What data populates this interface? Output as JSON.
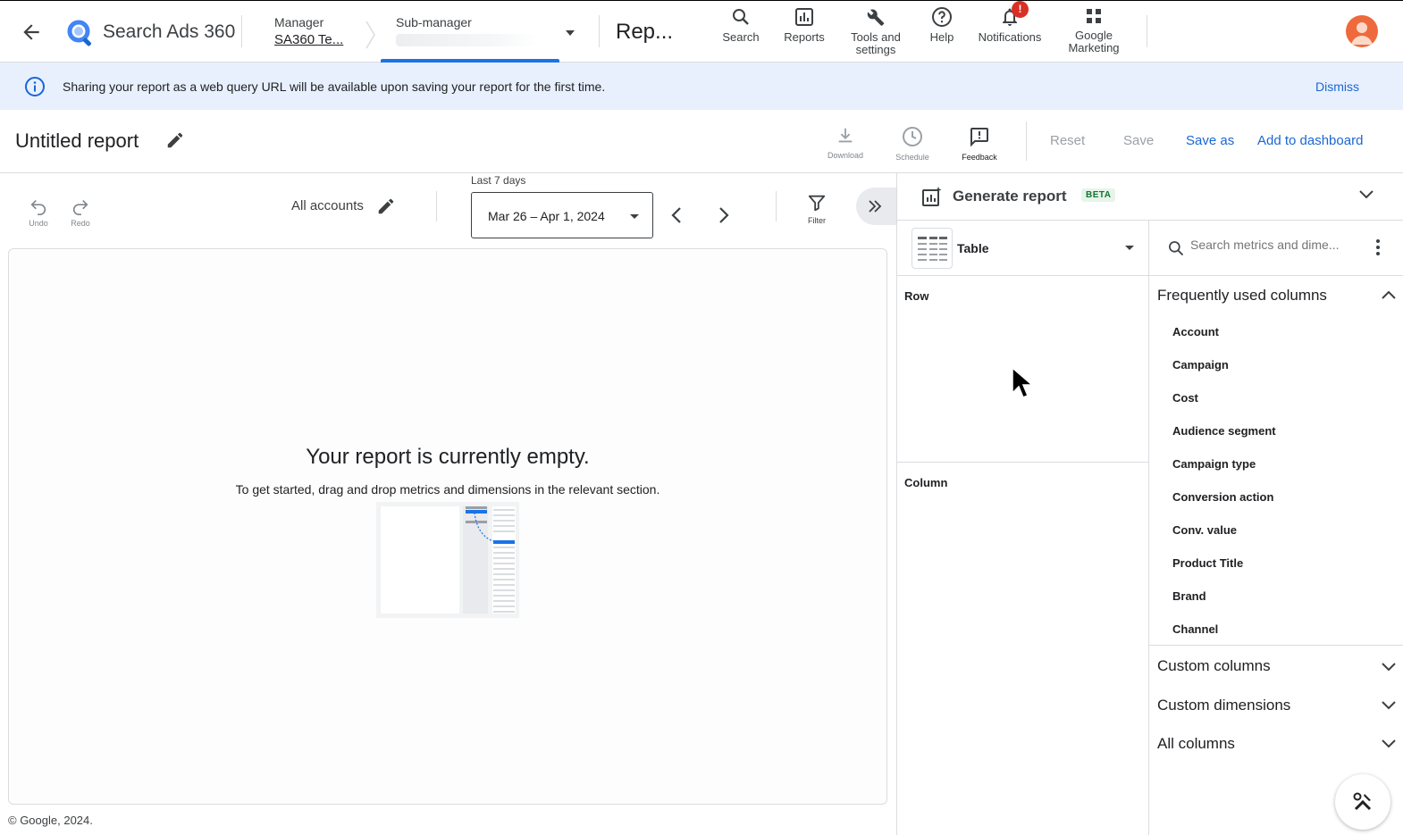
{
  "app": {
    "name": "Search Ads 360",
    "manager_label": "Manager",
    "manager_value": "SA360 Te...",
    "submanager_label": "Sub-manager",
    "page_title": "Rep..."
  },
  "nav": [
    {
      "label": "Search",
      "icon": "search-icon"
    },
    {
      "label": "Reports",
      "icon": "reports-icon"
    },
    {
      "label": "Tools and settings",
      "icon": "wrench-icon"
    },
    {
      "label": "Help",
      "icon": "help-icon"
    },
    {
      "label": "Notifications",
      "icon": "bell-icon",
      "badge": "!"
    },
    {
      "label": "Google Marketing",
      "icon": "apps-grid-icon"
    }
  ],
  "banner": {
    "text": "Sharing your report as a web query URL will be available upon saving your report for the first time.",
    "dismiss": "Dismiss"
  },
  "report": {
    "title": "Untitled report",
    "tools": {
      "download": "Download",
      "schedule": "Schedule",
      "feedback": "Feedback"
    },
    "actions": {
      "reset": "Reset",
      "save": "Save",
      "save_as": "Save as",
      "add_to_dashboard": "Add to dashboard"
    }
  },
  "controls": {
    "undo": "Undo",
    "redo": "Redo",
    "accounts": "All accounts",
    "date_caption": "Last 7 days",
    "date_range": "Mar 26 – Apr 1, 2024",
    "filter": "Filter"
  },
  "empty_state": {
    "heading": "Your report is currently empty.",
    "body": "To get started, drag and drop metrics and dimensions in the relevant section."
  },
  "footer": "© Google, 2024.",
  "panel": {
    "title": "Generate report",
    "badge": "BETA",
    "viz_type": "Table",
    "search_placeholder": "Search metrics and dime...",
    "row_label": "Row",
    "column_label": "Column",
    "frequent_title": "Frequently used columns",
    "frequent_columns": [
      "Account",
      "Campaign",
      "Cost",
      "Audience segment",
      "Campaign type",
      "Conversion action",
      "Conv. value",
      "Product Title",
      "Brand",
      "Channel"
    ],
    "sections": [
      "Custom columns",
      "Custom dimensions",
      "All columns"
    ]
  },
  "colors": {
    "accent": "#1a73e8",
    "banner_bg": "#e8f0fe",
    "badge_red": "#d93025",
    "avatar": "#ee6a3c"
  }
}
